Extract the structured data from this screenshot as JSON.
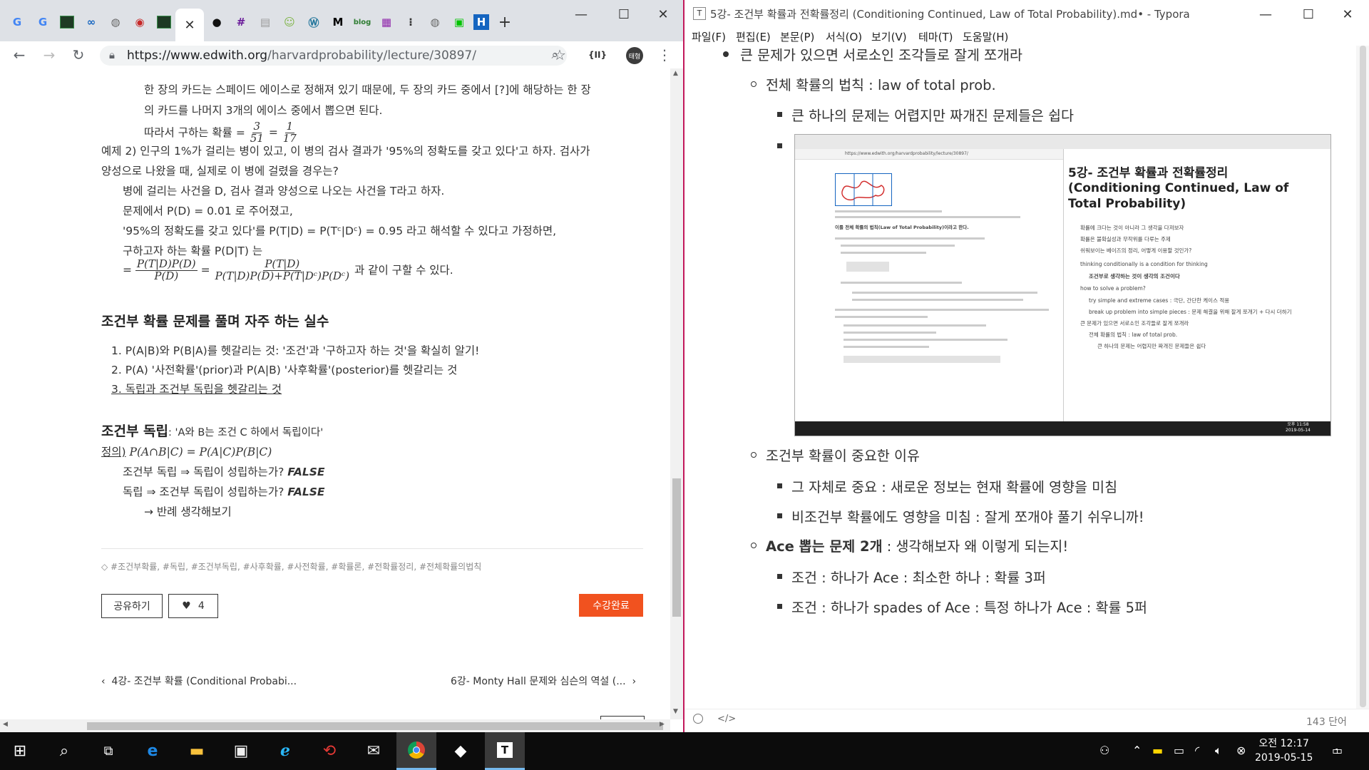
{
  "chrome": {
    "url_host": "https://www.edwith.org",
    "url_path": "/harvardprobability/lecture/30897/",
    "profile_label": "태형",
    "ext_label": "{II}"
  },
  "lecture": {
    "para1_line1": "한 장의 카드는 스페이드 에이스로 정해져 있기 때문에, 두 장의 카드 중에서 [?]에 해당하는 한 장",
    "para1_line2": "의 카드를 나머지 3개의 에이스 중에서 뽑으면 된다.",
    "answer_prefix": "따라서 구하는 확률 = ",
    "answer_frac1_num": "3",
    "answer_frac1_den": "51",
    "answer_frac2_num": "1",
    "answer_frac2_den": "17",
    "ex2_line1": "예제 2) 인구의 1%가 걸리는 병이 있고, 이 병의 검사 결과가 '95%의 정확도를 갖고 있다'고 하자. 검사가",
    "ex2_line2": "양성으로 나왔을 때, 실제로 이 병에 걸렸을 경우는?",
    "ex2_line3": "병에 걸리는 사건을 D, 검사 결과 양성으로 나오는 사건을 T라고 하자.",
    "ex2_line4": "문제에서 P(D) = 0.01 로 주어졌고,",
    "ex2_line5": "'95%의 정확도를 갖고 있다'를  P(T|D) = P(Tᶜ|Dᶜ) = 0.95 라고 해석할 수 있다고 가정하면,",
    "ex2_line6": "구하고자 하는 확률  P(D|T) 는",
    "ex2_formula_eq1_num": "P(T|D)P(D)",
    "ex2_formula_eq1_den": "P(D)",
    "ex2_formula_eq2_num": "P(T|D)",
    "ex2_formula_eq2_den": "P(T|D)P(D)+P(T|Dᶜ)P(Dᶜ)",
    "ex2_formula_suffix": "과 같이 구할 수 있다.",
    "mistakes_title": "조건부 확률 문제를 풀며 자주 하는 실수",
    "mistake1": "1. P(A|B)와 P(B|A)를 헷갈리는 것: '조건'과 '구하고자 하는 것'을 확실히 알기!",
    "mistake2": "2. P(A) '사전확률'(prior)과  P(A|B) '사후확률'(posterior)를 헷갈리는 것",
    "mistake3": "3. 독립과 조건부 독립을 헷갈리는 것",
    "indep_title": "조건부 독립",
    "indep_subtitle": ": 'A와 B는 조건 C 하에서 독립이다'",
    "indep_def_label": "정의)",
    "indep_def": "P(A∩B|C) = P(A|C)P(B|C)",
    "indep_line1": "조건부 독립  ⇒ 독립이 성립하는가?",
    "indep_line2": "독립 ⇒ 조건부 독립이 성립하는가?",
    "false_label": "FALSE",
    "indep_line3": "→ 반례 생각해보기",
    "tags": "#조건부확률, #독립, #조건부독립, #사후확률, #사전확률, #확률론, #전확률정리, #전체확률의법칙",
    "share_label": "공유하기",
    "like_count": "4",
    "complete_label": "수강완료",
    "prev_label": "4강- 조건부 확률 (Conditional Probabi...",
    "next_label": "6강- Monty Hall 문제와 심슨의 역설 (..."
  },
  "typora": {
    "window_title": "5강- 조건부 확률과 전확률정리 (Conditioning Continued, Law of Total Probability).md• - Typora",
    "menus": [
      "파일(F)",
      "편집(E)",
      "본문(P)",
      "서식(O)",
      "보기(V)",
      "테마(T)",
      "도움말(H)"
    ],
    "line_top": "큰 문제가 있으면 서로소인 조각들로 잘게 쪼개라",
    "line_total_prob": "전체 확률의 법칙 : law of total prob.",
    "line_subproblems": "큰 하나의 문제는 어렵지만 짜개진 문제들은 쉽다",
    "line_why": "조건부 확률이 중요한 이유",
    "line_itself": "그 자체로 중요 : 새로운 정보는 현재 확률에 영향을 미침",
    "line_noncond": "비조건부 확률에도 영향을 미침 : 잘게 쪼개야 풀기 쉬우니까!",
    "line_ace_bold": "Ace 뽑는 문제 2개",
    "line_ace_rest": " : 생각해보자 왜 이렇게 되는지!",
    "line_cond1": "조건 : 하나가 Ace : 최소한 하나 : 확률 3퍼",
    "line_cond2": "조건 : 하나가 spades of Ace : 특정 하나가 Ace : 확률 5퍼",
    "word_count": "143 단어",
    "status_source": "</>"
  },
  "embedded_shot": {
    "heading": "5강- 조건부 확률과 전확률정리 (Conditioning Continued, Law of Total Probability)",
    "url": "https://www.edwith.org/harvardprobability/lecture/30897/",
    "bullets": [
      "확률에 크다는 것이 아니라 그 생각을 다져보자",
      "확률은 불확실성과 무작위를 다루는 주제",
      "쉬워보이는 베이즈의 정리, 어떻게 이용할 것인가?",
      "thinking conditionally is a condition for thinking",
      "조건부로 생각하는 것이 생각의 조건이다",
      "how to solve a problem?",
      "try simple and extreme cases : 극단, 간단한 케이스 적용",
      "break up problem into simple pieces : 문제 해결을 위해 잘게 쪼개기 + 다시 더하기",
      "큰 문제가 있으면 서로소인 조각들로 잘게 쪼개라",
      "전체 확률의 법칙 : law of total prob.",
      "큰 하나의 문제는 어렵지만 짜개진 문제들은 쉽다"
    ],
    "left_heading": "이를 전체 확률의 법칙(Law of Total Probability)이라고 한다.",
    "clock_time": "오후 11:58",
    "clock_date": "2019-05-14"
  },
  "taskbar": {
    "clock_time": "오전 12:17",
    "clock_date": "2019-05-15",
    "notification_count": "1"
  }
}
